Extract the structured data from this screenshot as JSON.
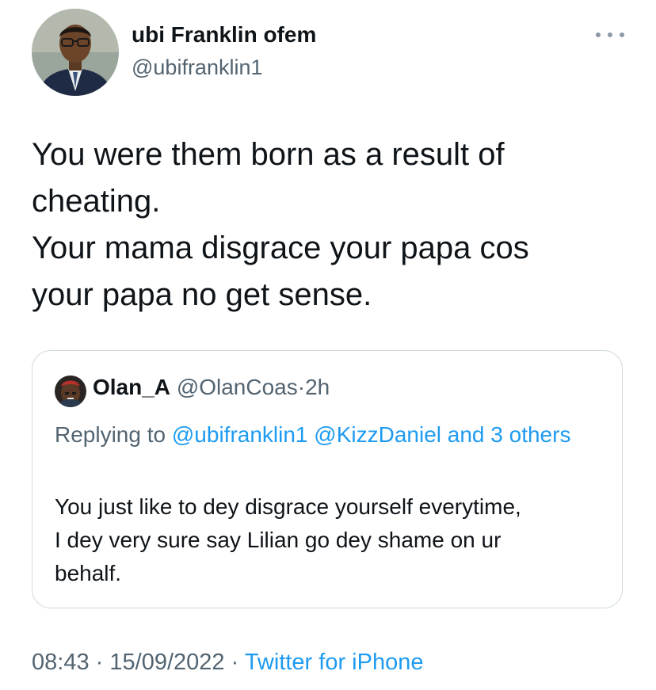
{
  "author": {
    "display_name": "ubi Franklin ofem",
    "handle": "@ubifranklin1"
  },
  "tweet": {
    "text_lines": [
      "You were them born as a result of",
      "cheating.",
      "Your mama disgrace your papa cos",
      "your papa no get sense."
    ]
  },
  "quoted_tweet": {
    "display_name": "Olan_A",
    "handle": "@OlanCoas",
    "separator": "·",
    "time": "2h",
    "replying_prefix": "Replying to",
    "replying_mentions": [
      "@ubifranklin1",
      "@KizzDaniel"
    ],
    "replying_and": "and 3",
    "replying_others": "others",
    "body_lines": [
      "You just like to dey disgrace yourself everytime,",
      "I dey very sure say Lilian go dey shame on ur",
      "behalf."
    ]
  },
  "meta": {
    "time": "08:43",
    "separator": "·",
    "date": "15/09/2022",
    "source": "Twitter for iPhone"
  },
  "colors": {
    "accent": "#1d9bf0",
    "text_primary": "#0f1419",
    "text_secondary": "#536471",
    "border": "#cfd9de"
  },
  "icons": {
    "more": "more-horizontal-icon"
  }
}
